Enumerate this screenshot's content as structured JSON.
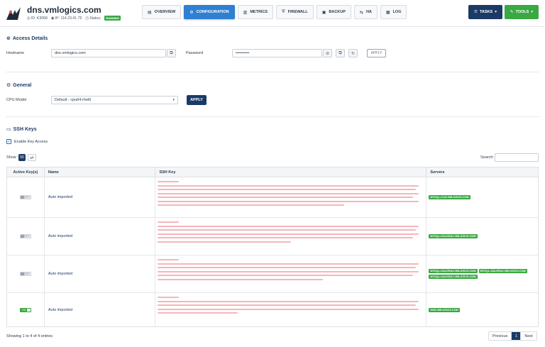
{
  "header": {
    "hostname": "dns.vmlogics.com",
    "id_label": "ID: K3068",
    "ip_label": "IP: 114.23.41.75",
    "status_label": "Status:",
    "status_value": "RUNNING",
    "tabs": [
      {
        "label": "OVERVIEW",
        "icon": "document-icon",
        "active": false
      },
      {
        "label": "CONFIGURATION",
        "icon": "gear-icon",
        "active": true
      },
      {
        "label": "METRICS",
        "icon": "chart-icon",
        "active": false
      },
      {
        "label": "FIREWALL",
        "icon": "shield-icon",
        "active": false
      },
      {
        "label": "BACKUP",
        "icon": "backup-icon",
        "active": false
      },
      {
        "label": "HA",
        "icon": "ha-icon",
        "active": false
      },
      {
        "label": "LOG",
        "icon": "log-icon",
        "active": false
      }
    ],
    "tasks_label": "TASKS",
    "tools_label": "TOOLS"
  },
  "access": {
    "title": "Access Details",
    "hostname_label": "Hostname",
    "hostname_value": "dns.vmlogics.com",
    "password_label": "Password",
    "password_value": "••••••••••",
    "apply_label": "APPLY"
  },
  "general": {
    "title": "General",
    "cpu_label": "CPU Model",
    "cpu_value": "Default - cpu64-rhel6",
    "apply_label": "APPLY"
  },
  "ssh": {
    "title": "SSH Keys",
    "enable_label": "Enable Key Access",
    "show_label": "Show",
    "show_value": "50",
    "search_label": "Search:",
    "columns": [
      "Active Key(s)",
      "Name",
      "SSH Key",
      "Servers"
    ],
    "rows": [
      {
        "active": "OFF",
        "name": "Auto imported",
        "servers": [
          "MYSQL-CLM.VMLOGICS.COM"
        ]
      },
      {
        "active": "OFF",
        "name": "Auto imported",
        "servers": [
          "MYSQL-GALERA2.VMLOGICS.COM"
        ]
      },
      {
        "active": "OFF",
        "name": "Auto imported",
        "servers": [
          "MYSQL-GALERA3.VMLOGICS.COM",
          "MYSQL-GALERA2.VMLOGICS.COM",
          "MYSQL-GALERA1.VMLOGICS.COM"
        ]
      },
      {
        "active": "ON",
        "name": "Auto imported",
        "servers": [
          "DNS.VMLOGICS.COM"
        ]
      }
    ],
    "footer": "Showing 1 to 4 of 4 entries",
    "prev_label": "Previous",
    "page": "1",
    "next_label": "Next"
  },
  "colors": {
    "navy": "#1b3a66",
    "accent_blue": "#2f7fd2",
    "green": "#3aa843",
    "redacted": "#f3a9ae"
  }
}
